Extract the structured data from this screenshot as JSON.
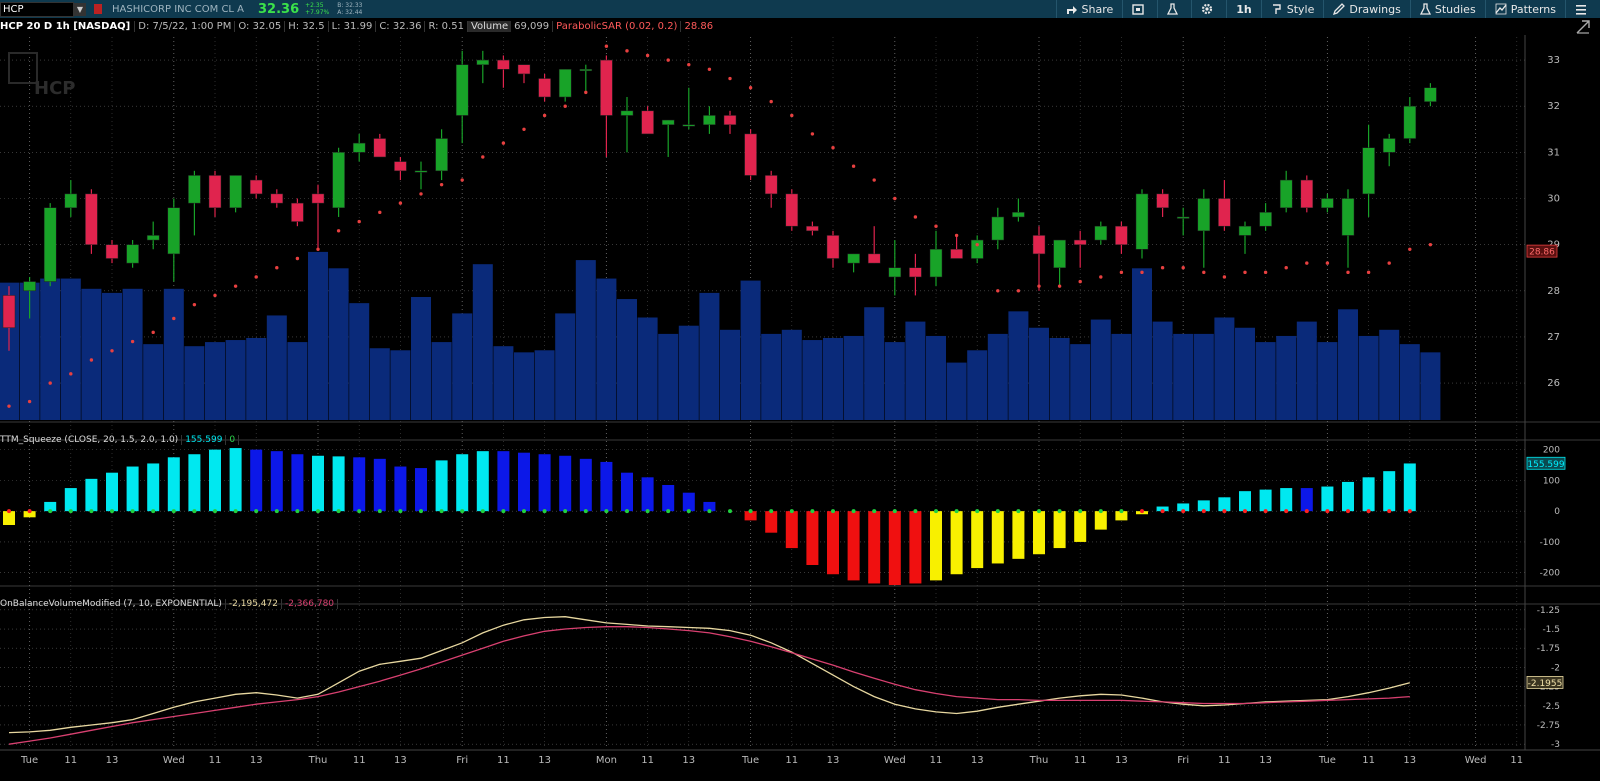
{
  "header": {
    "symbol": "HCP",
    "company": "HASHICORP INC COM CL A",
    "last_price": "32.36",
    "change": "+2.35",
    "change_pct": "+7.97%",
    "bid": "B: 32.33",
    "ask": "A: 32.44"
  },
  "toolbar": {
    "share": "Share",
    "timeframe": "1h",
    "style": "Style",
    "drawings": "Drawings",
    "studies": "Studies",
    "patterns": "Patterns"
  },
  "infobar": {
    "symbol_desc": "HCP 20 D 1h [NASDAQ]",
    "date": "D: 7/5/22, 1:00 PM",
    "open": "O: 32.05",
    "high": "H: 32.5",
    "low": "L: 31.99",
    "close": "C: 32.36",
    "range": "R: 0.51",
    "volume_label": "Volume",
    "volume_value": "69,099",
    "sar_label": "ParabolicSAR (0.02, 0.2)",
    "sar_value": "28.86"
  },
  "watermark": "HCP",
  "squeeze_label": {
    "name": "TTM_Squeeze (CLOSE, 20, 1.5, 2.0, 1.0)",
    "value1": "155.599",
    "value2": "0"
  },
  "obv_label": {
    "name": "OnBalanceVolumeModified (7, 10, EXPONENTIAL)",
    "value1": "-2,195,472",
    "value2": "-2,366,780"
  },
  "colors": {
    "up": "#18a328",
    "down": "#e0244e",
    "volume": "#0a2a7a",
    "sar": "#e84040",
    "squeeze_cyan": "#00e8f0",
    "squeeze_blue": "#0c18e8",
    "squeeze_red": "#f01010",
    "squeeze_yellow": "#f8f000",
    "obv_line": "#e8d8a0",
    "obv_signal": "#d84070"
  },
  "chart_data": [
    {
      "type": "candlestick",
      "title": "",
      "ylim": [
        25.2,
        33.5
      ],
      "y_ticks": [
        26,
        27,
        28,
        29,
        30,
        31,
        32,
        33
      ],
      "price_marker": "28.86",
      "x_labels": [
        "Tue",
        "11",
        "13",
        "Wed",
        "11",
        "13",
        "Thu",
        "11",
        "13",
        "Fri",
        "11",
        "13",
        "Mon",
        "11",
        "13",
        "Tue",
        "11",
        "13",
        "Wed",
        "11",
        "13",
        "Thu",
        "11",
        "13",
        "Fri",
        "11",
        "13",
        "Tue",
        "11",
        "13",
        "Wed",
        "11"
      ],
      "candles": [
        [
          27.9,
          28.1,
          26.7,
          27.2
        ],
        [
          28.0,
          28.3,
          27.4,
          28.2
        ],
        [
          28.2,
          29.9,
          28.1,
          29.8
        ],
        [
          29.8,
          30.4,
          29.6,
          30.1
        ],
        [
          30.1,
          30.2,
          28.8,
          29.0
        ],
        [
          29.0,
          29.1,
          28.6,
          28.7
        ],
        [
          28.6,
          29.1,
          28.5,
          29.0
        ],
        [
          29.1,
          29.5,
          28.9,
          29.2
        ],
        [
          28.8,
          30.0,
          28.2,
          29.8
        ],
        [
          29.9,
          30.6,
          29.2,
          30.5
        ],
        [
          30.5,
          30.6,
          29.6,
          29.8
        ],
        [
          29.8,
          30.5,
          29.7,
          30.5
        ],
        [
          30.4,
          30.5,
          30.0,
          30.1
        ],
        [
          30.1,
          30.2,
          29.8,
          29.9
        ],
        [
          29.9,
          30.0,
          29.4,
          29.5
        ],
        [
          30.1,
          30.3,
          28.9,
          29.9
        ],
        [
          29.8,
          31.1,
          29.6,
          31.0
        ],
        [
          31.0,
          31.4,
          30.8,
          31.2
        ],
        [
          31.3,
          31.4,
          30.9,
          30.9
        ],
        [
          30.8,
          30.9,
          30.4,
          30.6
        ],
        [
          30.6,
          30.8,
          30.2,
          30.6
        ],
        [
          30.6,
          31.5,
          30.4,
          31.3
        ],
        [
          31.8,
          33.2,
          31.2,
          32.9
        ],
        [
          32.9,
          33.2,
          32.5,
          33.0
        ],
        [
          33.0,
          33.1,
          32.4,
          32.8
        ],
        [
          32.9,
          32.9,
          32.5,
          32.7
        ],
        [
          32.6,
          32.7,
          32.1,
          32.2
        ],
        [
          32.2,
          32.8,
          32.1,
          32.8
        ],
        [
          32.8,
          32.9,
          32.3,
          32.8
        ],
        [
          33.0,
          33.1,
          30.9,
          31.8
        ],
        [
          31.8,
          32.2,
          31.0,
          31.9
        ],
        [
          31.9,
          32.0,
          31.4,
          31.4
        ],
        [
          31.6,
          31.7,
          30.9,
          31.7
        ],
        [
          31.6,
          32.4,
          31.5,
          31.6
        ],
        [
          31.6,
          32.0,
          31.4,
          31.8
        ],
        [
          31.8,
          31.9,
          31.4,
          31.6
        ],
        [
          31.4,
          31.5,
          30.4,
          30.5
        ],
        [
          30.5,
          30.6,
          29.8,
          30.1
        ],
        [
          30.1,
          30.2,
          29.3,
          29.4
        ],
        [
          29.4,
          29.5,
          29.2,
          29.3
        ],
        [
          29.2,
          29.3,
          28.5,
          28.7
        ],
        [
          28.6,
          28.8,
          28.4,
          28.8
        ],
        [
          28.8,
          29.4,
          28.6,
          28.6
        ],
        [
          28.3,
          29.1,
          27.9,
          28.5
        ],
        [
          28.5,
          28.8,
          27.9,
          28.3
        ],
        [
          28.3,
          29.3,
          28.1,
          28.9
        ],
        [
          28.9,
          29.2,
          28.7,
          28.7
        ],
        [
          28.7,
          29.2,
          28.6,
          29.1
        ],
        [
          29.1,
          29.8,
          28.9,
          29.6
        ],
        [
          29.6,
          30.0,
          29.5,
          29.7
        ],
        [
          29.2,
          29.4,
          28.0,
          28.8
        ],
        [
          28.5,
          29.1,
          28.1,
          29.1
        ],
        [
          29.1,
          29.3,
          28.5,
          29.0
        ],
        [
          29.1,
          29.5,
          29.0,
          29.4
        ],
        [
          29.4,
          29.5,
          28.8,
          29.0
        ],
        [
          28.9,
          30.2,
          28.7,
          30.1
        ],
        [
          30.1,
          30.2,
          29.6,
          29.8
        ],
        [
          29.6,
          29.8,
          29.2,
          29.6
        ],
        [
          29.3,
          30.2,
          28.5,
          30.0
        ],
        [
          30.0,
          30.4,
          29.3,
          29.4
        ],
        [
          29.2,
          29.5,
          28.8,
          29.4
        ],
        [
          29.4,
          29.9,
          29.3,
          29.7
        ],
        [
          29.8,
          30.6,
          29.7,
          30.4
        ],
        [
          30.4,
          30.5,
          29.7,
          29.8
        ],
        [
          29.8,
          30.1,
          29.7,
          30.0
        ],
        [
          29.2,
          30.2,
          28.5,
          30.0
        ],
        [
          30.1,
          31.6,
          29.6,
          31.1
        ],
        [
          31.0,
          31.4,
          30.7,
          31.3
        ],
        [
          31.3,
          32.2,
          31.2,
          32.0
        ],
        [
          32.1,
          32.5,
          32.0,
          32.4
        ]
      ],
      "sar": [
        25.5,
        25.6,
        26.0,
        26.2,
        26.5,
        26.7,
        26.9,
        27.1,
        27.4,
        27.7,
        27.9,
        28.1,
        28.3,
        28.5,
        28.7,
        28.9,
        29.3,
        29.5,
        29.7,
        29.9,
        30.1,
        30.3,
        30.4,
        30.9,
        31.2,
        31.5,
        31.8,
        32.0,
        32.3,
        33.3,
        33.2,
        33.1,
        33.0,
        32.9,
        32.8,
        32.6,
        32.4,
        32.1,
        31.8,
        31.4,
        31.1,
        30.7,
        30.4,
        30.0,
        29.6,
        29.4,
        29.2,
        29.0,
        28.0,
        28.0,
        28.1,
        28.1,
        28.2,
        28.3,
        28.4,
        28.4,
        28.5,
        28.5,
        28.4,
        28.3,
        28.4,
        28.4,
        28.5,
        28.6,
        28.6,
        28.4,
        28.4,
        28.6,
        28.9,
        29.0
      ],
      "volume": [
        67,
        67,
        69,
        69,
        64,
        62,
        64,
        37,
        64,
        36,
        38,
        39,
        40,
        51,
        38,
        82,
        74,
        57,
        35,
        34,
        60,
        38,
        52,
        76,
        36,
        33,
        34,
        52,
        78,
        69,
        59,
        50,
        42,
        46,
        62,
        44,
        68,
        42,
        44,
        39,
        40,
        41,
        55,
        38,
        48,
        41,
        28,
        34,
        42,
        53,
        45,
        40,
        37,
        49,
        42,
        74,
        48,
        42,
        42,
        50,
        45,
        38,
        41,
        48,
        38,
        54,
        41,
        44,
        37,
        33
      ]
    },
    {
      "type": "bar",
      "title": "TTM_Squeeze",
      "ylim": [
        -240,
        215
      ],
      "y_ticks": [
        200,
        100,
        0,
        -100,
        -200
      ],
      "price_marker": "155.599",
      "values": [
        -45,
        -20,
        30,
        75,
        105,
        125,
        145,
        155,
        175,
        185,
        200,
        205,
        200,
        195,
        185,
        180,
        178,
        175,
        170,
        145,
        140,
        165,
        185,
        195,
        195,
        190,
        185,
        180,
        170,
        160,
        125,
        110,
        85,
        60,
        30,
        0,
        -30,
        -70,
        -120,
        -175,
        -205,
        -225,
        -235,
        -240,
        -235,
        -225,
        -205,
        -185,
        -170,
        -155,
        -140,
        -120,
        -100,
        -60,
        -30,
        -10,
        15,
        25,
        35,
        45,
        65,
        70,
        75,
        75,
        80,
        95,
        110,
        130,
        155
      ],
      "bar_colors": [
        "yellow",
        "yellow",
        "cyan",
        "cyan",
        "cyan",
        "cyan",
        "cyan",
        "cyan",
        "cyan",
        "cyan",
        "cyan",
        "cyan",
        "blue",
        "blue",
        "blue",
        "cyan",
        "cyan",
        "blue",
        "blue",
        "blue",
        "blue",
        "cyan",
        "cyan",
        "cyan",
        "blue",
        "blue",
        "blue",
        "blue",
        "blue",
        "blue",
        "blue",
        "blue",
        "blue",
        "blue",
        "blue",
        "none",
        "red",
        "red",
        "red",
        "red",
        "red",
        "red",
        "red",
        "red",
        "red",
        "yellow",
        "yellow",
        "yellow",
        "yellow",
        "yellow",
        "yellow",
        "yellow",
        "yellow",
        "yellow",
        "yellow",
        "yellow",
        "cyan",
        "cyan",
        "cyan",
        "cyan",
        "cyan",
        "cyan",
        "cyan",
        "blue",
        "cyan",
        "cyan",
        "cyan",
        "cyan",
        "cyan"
      ],
      "dot_colors": [
        "red",
        "red",
        "green",
        "green",
        "green",
        "green",
        "green",
        "green",
        "green",
        "green",
        "green",
        "green",
        "green",
        "green",
        "green",
        "green",
        "green",
        "green",
        "green",
        "green",
        "green",
        "green",
        "green",
        "green",
        "green",
        "green",
        "green",
        "green",
        "green",
        "green",
        "green",
        "green",
        "green",
        "green",
        "green",
        "green",
        "green",
        "green",
        "green",
        "green",
        "green",
        "green",
        "green",
        "green",
        "green",
        "green",
        "green",
        "green",
        "green",
        "green",
        "green",
        "green",
        "green",
        "green",
        "green",
        "red",
        "red",
        "red",
        "red",
        "red",
        "red",
        "red",
        "red",
        "red",
        "red",
        "red",
        "red",
        "red",
        "red"
      ]
    },
    {
      "type": "line",
      "title": "OnBalanceVolumeModified",
      "ylim": [
        -3.05,
        -1.2
      ],
      "y_ticks": [
        -1.25,
        -1.5,
        -1.75,
        -2,
        -2.25,
        -2.5,
        -2.75,
        -3
      ],
      "price_marker": "-2.1955",
      "series": [
        {
          "name": "",
          "values": [
            -2.85,
            -2.84,
            -2.82,
            -2.78,
            -2.75,
            -2.72,
            -2.68,
            -2.6,
            -2.52,
            -2.45,
            -2.4,
            -2.35,
            -2.33,
            -2.36,
            -2.4,
            -2.35,
            -2.2,
            -2.05,
            -1.96,
            -1.92,
            -1.88,
            -1.78,
            -1.68,
            -1.55,
            -1.45,
            -1.38,
            -1.35,
            -1.34,
            -1.38,
            -1.42,
            -1.44,
            -1.46,
            -1.47,
            -1.48,
            -1.49,
            -1.52,
            -1.58,
            -1.68,
            -1.8,
            -1.95,
            -2.1,
            -2.25,
            -2.38,
            -2.48,
            -2.54,
            -2.58,
            -2.6,
            -2.57,
            -2.52,
            -2.48,
            -2.44,
            -2.4,
            -2.37,
            -2.35,
            -2.36,
            -2.4,
            -2.45,
            -2.48,
            -2.5,
            -2.49,
            -2.47,
            -2.45,
            -2.44,
            -2.43,
            -2.42,
            -2.38,
            -2.33,
            -2.27,
            -2.2
          ]
        },
        {
          "name": "",
          "values": [
            -3.0,
            -2.96,
            -2.92,
            -2.87,
            -2.82,
            -2.77,
            -2.72,
            -2.68,
            -2.64,
            -2.6,
            -2.56,
            -2.52,
            -2.48,
            -2.45,
            -2.42,
            -2.38,
            -2.32,
            -2.25,
            -2.18,
            -2.1,
            -2.02,
            -1.93,
            -1.84,
            -1.75,
            -1.66,
            -1.59,
            -1.53,
            -1.5,
            -1.48,
            -1.47,
            -1.47,
            -1.48,
            -1.5,
            -1.52,
            -1.55,
            -1.6,
            -1.66,
            -1.73,
            -1.81,
            -1.89,
            -1.97,
            -2.06,
            -2.14,
            -2.22,
            -2.29,
            -2.34,
            -2.38,
            -2.4,
            -2.42,
            -2.42,
            -2.43,
            -2.43,
            -2.43,
            -2.43,
            -2.43,
            -2.44,
            -2.45,
            -2.46,
            -2.47,
            -2.47,
            -2.47,
            -2.46,
            -2.45,
            -2.44,
            -2.43,
            -2.42,
            -2.41,
            -2.4,
            -2.38
          ]
        }
      ]
    }
  ]
}
